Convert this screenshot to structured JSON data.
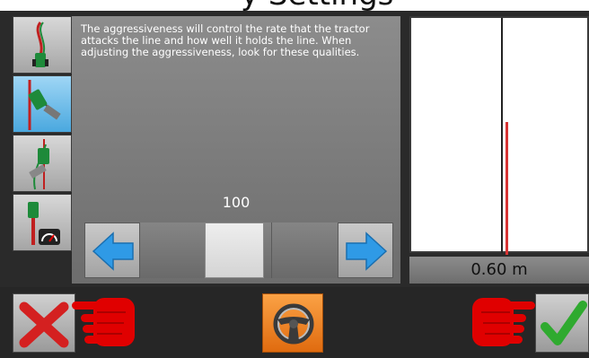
{
  "header": {
    "title": "y Settings"
  },
  "mode_buttons": [
    {
      "name": "line-acquisition-mode",
      "selected": false
    },
    {
      "name": "aggressiveness-mode",
      "selected": true
    },
    {
      "name": "curve-response-mode",
      "selected": false
    },
    {
      "name": "speed-gauge-mode",
      "selected": false
    }
  ],
  "description": "The aggressiveness will control the rate that the tractor attacks the line and how well it holds the line. When adjusting the aggressiveness, look for these qualities.",
  "slider": {
    "value": "100",
    "decrease_icon": "arrow-left-icon",
    "increase_icon": "arrow-right-icon",
    "position_fraction": 0.5
  },
  "preview": {
    "offset": "0.60 m"
  },
  "footer": {
    "cancel_icon": "cancel-x-icon",
    "steering_icon": "steering-wheel-icon",
    "accept_icon": "checkmark-icon"
  },
  "colors": {
    "selected_blue": "#4aa8df",
    "arrow_blue": "#2f9ae6",
    "accent_orange": "#f0831e",
    "hint_red": "#e00000",
    "line_red": "#d83434",
    "tractor_green": "#1e8a3a",
    "check_green": "#2faa2f"
  }
}
